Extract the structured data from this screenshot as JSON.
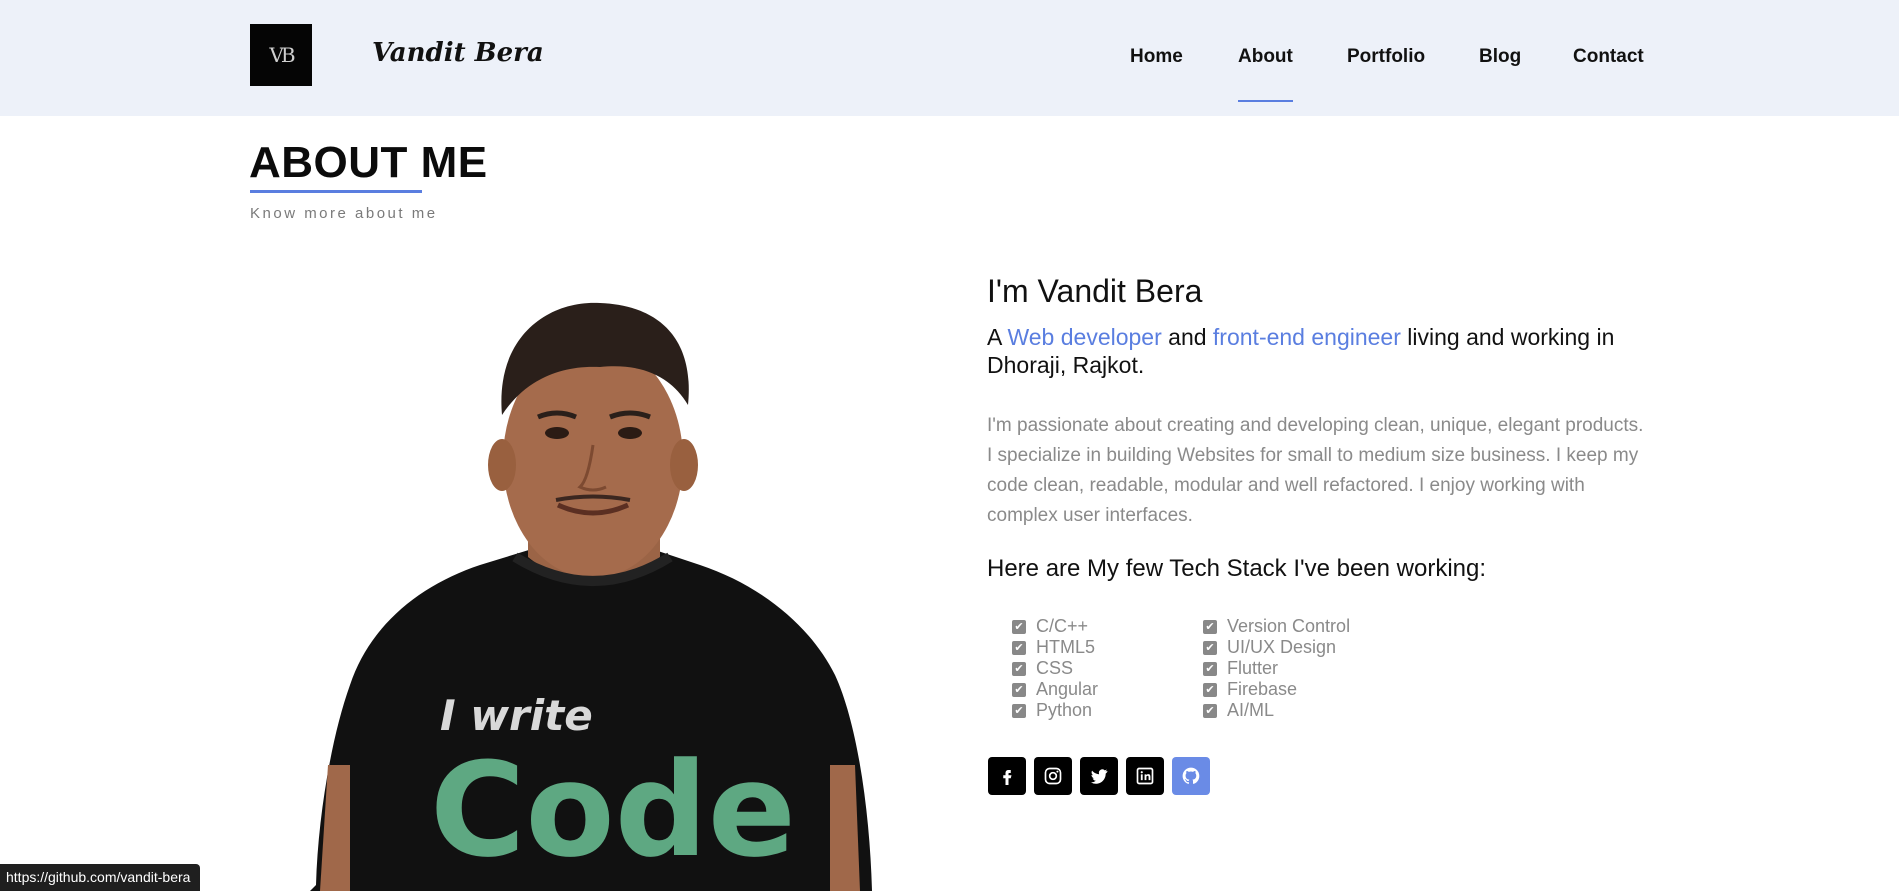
{
  "brand": {
    "logo_text": "VB",
    "name": "Vandit Bera"
  },
  "nav": {
    "items": [
      "Home",
      "About",
      "Portfolio",
      "Blog",
      "Contact"
    ],
    "active": "About"
  },
  "section": {
    "title": "ABOUT ME",
    "subtitle": "Know more about me"
  },
  "profile": {
    "name": "I'm Vandit Bera",
    "tagline": {
      "prefix": "A ",
      "role1": "Web developer",
      "mid": " and ",
      "role2": "front-end engineer",
      "suffix": " living and working in Dhoraji, Rajkot."
    },
    "bio": "I'm passionate about creating and developing clean, unique, elegant products. I specialize in building Websites for small to medium size business. I keep my code clean, readable, modular and well refactored. I enjoy working with complex user interfaces.",
    "photo_shirt_text": {
      "line1": "I write",
      "line2": "Code"
    }
  },
  "tech": {
    "heading": "Here are My few Tech Stack I've been working:",
    "col1": [
      "C/C++",
      "HTML5",
      "CSS",
      "Angular",
      "Python"
    ],
    "col2": [
      "Version Control",
      "UI/UX Design",
      "Flutter",
      "Firebase",
      "AI/ML"
    ]
  },
  "socials": [
    {
      "icon": "facebook-icon"
    },
    {
      "icon": "instagram-icon"
    },
    {
      "icon": "twitter-icon"
    },
    {
      "icon": "linkedin-icon"
    },
    {
      "icon": "github-icon",
      "hovered": true
    }
  ],
  "status_bar": {
    "url": "https://github.com/vandit-bera"
  },
  "colors": {
    "accent": "#5a7ee0",
    "navbar_bg": "#edf1f9",
    "muted_text": "#8a8a8a"
  }
}
